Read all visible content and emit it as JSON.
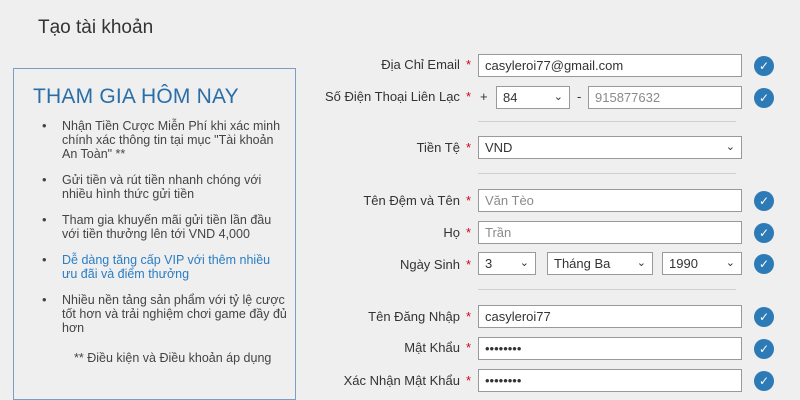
{
  "page": {
    "title": "Tạo tài khoản"
  },
  "promo": {
    "heading": "THAM GIA HÔM NAY",
    "items": [
      "Nhận Tiền Cược Miễn Phí khi xác minh chính xác thông tin tại mục \"Tài khoản An Toàn\" **",
      "Gửi tiền và rút tiền nhanh chóng với nhiều hình thức gửi tiền",
      "Tham gia khuyến mãi gửi tiền lần đầu với tiền thưởng lên tới VND 4,000",
      "Dễ dàng tăng cấp VIP với thêm nhiều ưu đãi và điểm thưởng",
      "Nhiều nền tảng sản phẩm với tỷ lệ cược tốt hơn và trải nghiệm chơi game đầy đủ hơn"
    ],
    "note": "** Điều kiện và Điều khoản áp dụng"
  },
  "form": {
    "required_mark": "*",
    "email": {
      "label": "Địa Chỉ Email",
      "value": "casyleroi77@gmail.com"
    },
    "phone": {
      "label": "Số Điện Thoại Liên Lạc",
      "plus": "+",
      "code": "84",
      "dash": "-",
      "value": "915877632"
    },
    "currency": {
      "label": "Tiền Tệ",
      "value": "VND"
    },
    "first_name": {
      "label": "Tên Đệm và Tên",
      "placeholder": "Văn Tèo"
    },
    "last_name": {
      "label": "Họ",
      "placeholder": "Trần"
    },
    "birthday": {
      "label": "Ngày Sinh",
      "day": "3",
      "month": "Tháng Ba",
      "year": "1990"
    },
    "username": {
      "label": "Tên Đăng Nhập",
      "value": "casyleroi77"
    },
    "password": {
      "label": "Mật Khẩu",
      "value": "••••••••"
    },
    "confirm_password": {
      "label": "Xác Nhận Mật Khẩu",
      "value": "••••••••"
    }
  },
  "icons": {
    "valid": "check-circle-icon",
    "dropdown": "chevron-down-icon"
  },
  "colors": {
    "accent": "#2c7bb6",
    "heading": "#2a6ea8",
    "required": "#d0021b"
  }
}
